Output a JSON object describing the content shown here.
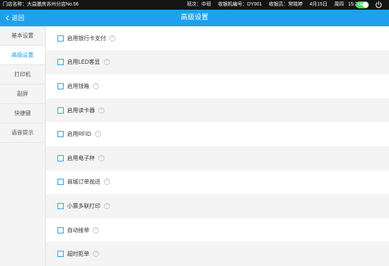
{
  "status_bar": {
    "store": "门店名称：大益膳房苏州分店No.56",
    "shift": "班次：中班",
    "register": "收银机编号：DY001",
    "cashier": "收银员：常晓婷",
    "date": "4月15日",
    "weekday": "周四",
    "time": "15:21",
    "toggle_text": "ON",
    "toggle_color": "#4cd964"
  },
  "header": {
    "back_label": "返回",
    "title": "高级设置",
    "color": "#1fa0ef"
  },
  "sidebar": {
    "items": [
      {
        "label": "基本设置"
      },
      {
        "label": "高级设置"
      },
      {
        "label": "打印机"
      },
      {
        "label": "副屏"
      },
      {
        "label": "快捷键"
      },
      {
        "label": "语音提示"
      }
    ],
    "active_index": 1
  },
  "settings": [
    {
      "label": "启用银行卡支付",
      "checked": false
    },
    {
      "label": "启用LED客显",
      "checked": false
    },
    {
      "label": "启用钱箱",
      "checked": false
    },
    {
      "label": "启用读卡器",
      "checked": false
    },
    {
      "label": "启用RFID",
      "checked": false
    },
    {
      "label": "启用电子秤",
      "checked": false
    },
    {
      "label": "商城订单抛送",
      "checked": false
    },
    {
      "label": "小票多联打印",
      "checked": false
    },
    {
      "label": "自动接单",
      "checked": false
    },
    {
      "label": "超时拒单",
      "checked": false
    }
  ],
  "help_glyph": "?"
}
